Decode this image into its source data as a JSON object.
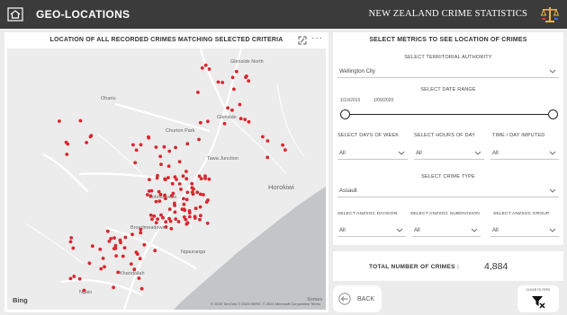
{
  "header": {
    "title": "GEO-LOCATIONS",
    "subtitle": "NEW ZEALAND CRIME STATISTICS"
  },
  "map": {
    "title": "LOCATION OF ALL RECORDED CRIMES MATCHING SELECTED CRITERIA",
    "provider": "Bing",
    "copyright": "© 2020 TomTom © 2020 HERE, © 2020 Microsoft Corporation  Terms",
    "place_labels": {
      "glenside_north": "Glenside North",
      "ohariu": "Ohariu",
      "glenside": "Glenside",
      "churton_park": "Churton Park",
      "tawa_junction": "Tawa Junction",
      "johnsonville": "Johnsonville",
      "horokiwi": "Horokiwi",
      "broadmeadows": "Broadmeadows",
      "ngauranga": "Ngauranga",
      "khandallah": "Khandallah",
      "ngaio": "Ngaio",
      "somes": "Somes"
    },
    "marker_color": "#d9262e"
  },
  "filters": {
    "heading": "SELECT METRICS TO SEE LOCATION OF CRIMES",
    "territorial_authority": {
      "label": "SELECT TERRITORIAL AUTHORITY",
      "value": "Wellington City"
    },
    "date_range": {
      "label": "SELECT DATE RANGE",
      "start": "1/10/2015",
      "end": "1/09/2020"
    },
    "days_of_week": {
      "label": "SELECT DAYS OF WEEK",
      "value": "All"
    },
    "hours_of_day": {
      "label": "SELECT HOURS OF DAY",
      "value": "All"
    },
    "time_day_imputed": {
      "label": "TIME / DAY IMPUTED",
      "value": "All"
    },
    "crime_type": {
      "label": "SELECT CRIME TYPE",
      "value": "Assault"
    },
    "anzsoc_division": {
      "label": "SELECT ANZSOC DIVISION",
      "value": "All"
    },
    "anzsoc_subdivision": {
      "label": "SELECT ANZSOC SUBDIVISION",
      "value": "All"
    },
    "anzsoc_group": {
      "label": "SELECT ANZSOC GROUP",
      "value": "All"
    }
  },
  "totals": {
    "label": "TOTAL NUMBER OF CRIMES :",
    "value": "4,884"
  },
  "buttons": {
    "back": "BACK",
    "clear_filters": "CLEAR FILTERS"
  },
  "icons": {
    "home": "home-icon",
    "scales": "scales-of-justice-icon",
    "focus": "focus-mode-icon",
    "more": "more-options-icon",
    "chevron": "chevron-down-icon",
    "back": "back-arrow-icon",
    "clear": "clear-filter-icon"
  },
  "colors": {
    "header_bg": "#3b3b3b",
    "sea": "#c4c5c7",
    "land": "#ebeceb"
  }
}
